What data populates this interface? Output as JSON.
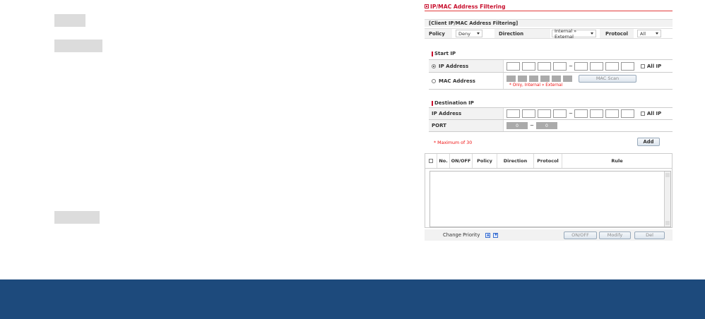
{
  "panel": {
    "title": "IP/MAC Address Filtering",
    "subtitle": "[Client IP/MAC Address Filtering]",
    "policy_label": "Policy",
    "policy_value": "Deny",
    "direction_label": "Direction",
    "direction_value": "Internal » External",
    "protocol_label": "Protocol",
    "protocol_value": "All"
  },
  "start_ip": {
    "section": "Start IP",
    "ip_label": "IP Address",
    "all_ip": "All IP",
    "mac_label": "MAC Address",
    "mac_scan": "MAC Scan",
    "note": "* Only, Internal » External"
  },
  "dest": {
    "section": "Destination IP",
    "ip_label": "IP Address",
    "all_ip": "All IP",
    "port_label": "PORT",
    "port_from": "0",
    "port_to": "0",
    "tilde": "~"
  },
  "limit_note": "* Maximum of 30",
  "add_button": "Add",
  "list_headers": [
    "No.",
    "ON/OFF",
    "Policy",
    "Direction",
    "Protocol",
    "Rule"
  ],
  "bottom": {
    "change_priority": "Change Priority",
    "onoff": "ON/OFF",
    "modify": "Modify",
    "del": "Del"
  },
  "colors": {
    "accent": "#c8102e",
    "footer": "#1d4a7c"
  }
}
